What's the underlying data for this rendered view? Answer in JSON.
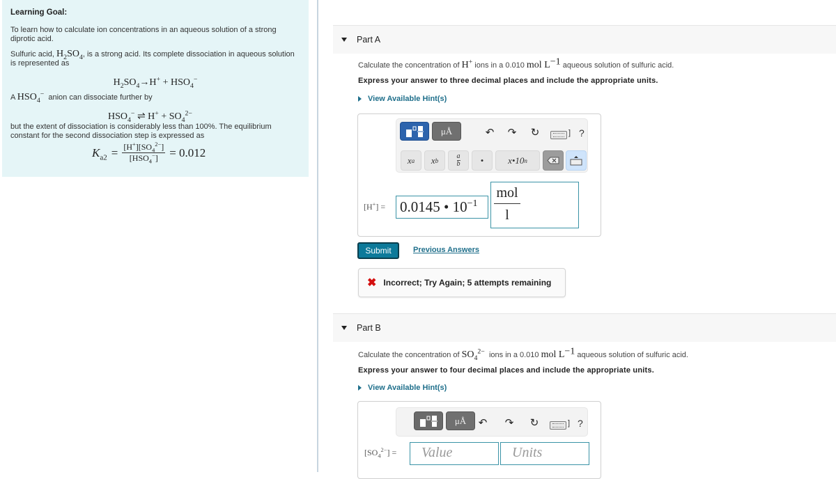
{
  "learning_goal": {
    "title": "Learning Goal:",
    "intro": "To learn how to calculate ion concentrations in an aqueous solution of a strong diprotic acid.",
    "p2_pre": "Sulfuric acid, ",
    "p2_formula": "H2SO4",
    "p2_post": ", is a strong acid. Its complete dissociation in aqueous solution is represented as",
    "eq1": "H2SO4→H+ + HSO4−",
    "p3_pre": "A ",
    "p3_formula": "HSO4−",
    "p3_post": " anion can dissociate further by",
    "eq2": "HSO4− ⇌ H+ + SO42−",
    "p4": "but the extent of dissociation is considerably less than 100%. The equilibrium constant for the second dissociation step is expressed as",
    "ka_symbol": "K",
    "ka_sub": "a2",
    "ka_numerator": "[H+][SO42−]",
    "ka_denominator": "[HSO4−]",
    "ka_value": "= 0.012"
  },
  "part_a": {
    "label": "Part A",
    "question_pre": "Calculate the concentration of ",
    "question_species": "H",
    "question_species_sup": "+",
    "question_mid": " ions in a 0.010 ",
    "question_unit": "mol L",
    "question_unit_sup": "−1",
    "question_post": " aqueous solution of sulfuric acid.",
    "instruction": "Express your answer to three decimal places and include the appropriate units.",
    "hint_label": "View Available Hint(s)",
    "answer_label": "[H+] =",
    "value": "0.0145 • 10",
    "value_exp": "−1",
    "units_numerator": "mol",
    "units_denominator": "l",
    "units_button": "μÅ",
    "keys": [
      "xa",
      "xb",
      "a/b",
      "•",
      "x•10n"
    ],
    "submit_label": "Submit",
    "previous_answers_label": "Previous Answers",
    "feedback": "Incorrect; Try Again; 5 attempts remaining"
  },
  "part_b": {
    "label": "Part B",
    "question_pre": "Calculate the concentration of ",
    "question_species": "SO",
    "question_species_sub": "4",
    "question_species_sup": "2−",
    "question_mid": " ions in a 0.010 ",
    "question_unit": "mol L",
    "question_unit_sup": "−1",
    "question_post": " aqueous solution of sulfuric acid.",
    "instruction": "Express your answer to four decimal places and include the appropriate units.",
    "hint_label": "View Available Hint(s)",
    "answer_label": "[SO42−] =",
    "value_placeholder": "Value",
    "units_placeholder": "Units",
    "units_button": "μÅ"
  },
  "toolbar": {
    "help": "?"
  }
}
